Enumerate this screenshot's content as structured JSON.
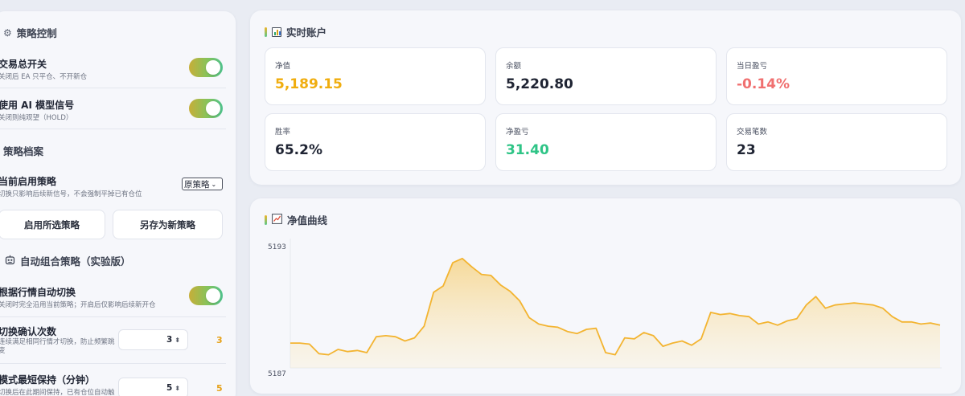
{
  "strategy_control": {
    "title": "策略控制",
    "icon": "gear-icon",
    "master_switch": {
      "title": "交易总开关",
      "desc": "关闭后 EA 只平仓、不开新仓",
      "on": true
    },
    "ai_signal": {
      "title": "使用 AI 模型信号",
      "desc": "关闭则纯观望（HOLD）",
      "on": true
    }
  },
  "strategy_profile": {
    "title": "策略档案",
    "current": {
      "title": "当前启用策略",
      "desc": "切换只影响后续新信号，不会强制平掉已有仓位",
      "selected": "原策略"
    },
    "apply_button": "启用所选策略",
    "save_button": "另存为新策略"
  },
  "auto_combo": {
    "title": "自动组合策略（实验版）",
    "icon": "robot-icon",
    "auto_switch": {
      "title": "根据行情自动切换",
      "desc": "关闭时完全沿用当前策略；开启后仅影响后续新开仓",
      "on": true
    },
    "confirm_count": {
      "title": "切换确认次数",
      "desc": "连续满足相同行情才切换，防止频繁跳变",
      "value": "3",
      "display": "3"
    },
    "min_hold": {
      "title": "模式最短保持（分钟）",
      "desc": "切换后在此期间保持，已有仓位自动触",
      "value": "5",
      "display": "5"
    }
  },
  "account": {
    "title": "实时账户",
    "icon": "bar-chart-icon",
    "stats": [
      {
        "label": "净值",
        "value": "5,189.15",
        "color": "#f0ad0e"
      },
      {
        "label": "余额",
        "value": "5,220.80",
        "color": "#1f2433"
      },
      {
        "label": "当日盈亏",
        "value": "-0.14%",
        "color": "#f07070"
      },
      {
        "label": "胜率",
        "value": "65.2%",
        "color": "#1f2433"
      },
      {
        "label": "净盈亏",
        "value": "31.40",
        "color": "#2ec486"
      },
      {
        "label": "交易笔数",
        "value": "23",
        "color": "#1f2433"
      }
    ]
  },
  "equity_curve": {
    "title": "净值曲线",
    "icon": "line-chart-icon"
  },
  "chart_data": {
    "type": "area",
    "title": "净值曲线",
    "xlabel": "",
    "ylabel": "",
    "ylim": [
      5187,
      5193
    ],
    "yticks": [
      "5193",
      "5187"
    ],
    "grid": false,
    "legend": "none",
    "color": "#f3b431",
    "series": [
      {
        "values": [
          5188.4,
          5188.4,
          5188.35,
          5187.9,
          5187.85,
          5188.1,
          5188.0,
          5188.05,
          5187.95,
          5188.7,
          5188.75,
          5188.7,
          5188.5,
          5188.65,
          5189.2,
          5190.8,
          5191.1,
          5192.2,
          5192.4,
          5192.0,
          5191.65,
          5191.6,
          5191.15,
          5190.85,
          5190.4,
          5189.6,
          5189.3,
          5189.2,
          5189.15,
          5188.95,
          5188.85,
          5189.05,
          5189.1,
          5187.95,
          5187.85,
          5188.65,
          5188.6,
          5188.9,
          5188.75,
          5188.25,
          5188.4,
          5188.5,
          5188.3,
          5188.6,
          5189.85,
          5189.75,
          5189.8,
          5189.7,
          5189.65,
          5189.3,
          5189.4,
          5189.25,
          5189.45,
          5189.55,
          5190.2,
          5190.6,
          5190.05,
          5190.2,
          5190.25,
          5190.3,
          5190.25,
          5190.2,
          5190.05,
          5189.65,
          5189.4,
          5189.4,
          5189.3,
          5189.35,
          5189.25
        ]
      }
    ]
  }
}
